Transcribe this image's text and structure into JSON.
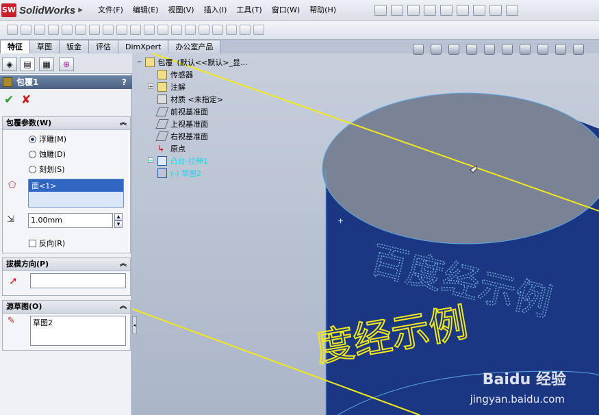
{
  "app": {
    "brand_logo": "SW",
    "name": "SolidWorks"
  },
  "menu": [
    "文件(F)",
    "编辑(E)",
    "视图(V)",
    "插入(I)",
    "工具(T)",
    "窗口(W)",
    "帮助(H)"
  ],
  "tabs": [
    "特征",
    "草图",
    "钣金",
    "评估",
    "DimXpert",
    "办公室产品"
  ],
  "active_tab": "特征",
  "property_manager": {
    "title": "包覆1",
    "help": "?",
    "ok": "✔",
    "cancel": "✘",
    "sections": {
      "params": {
        "title": "包覆参数(W)",
        "options": [
          "浮雕(M)",
          "蚀雕(D)",
          "刻划(S)"
        ],
        "selected_option": "浮雕(M)",
        "face_list": [
          "面<1>"
        ],
        "thickness": "1.00mm",
        "reverse_label": "反向(R)"
      },
      "pull": {
        "title": "拔模方向(P)",
        "value": ""
      },
      "source": {
        "title": "源草图(O)",
        "sketch": "草图2"
      }
    }
  },
  "tree": {
    "root": "包覆",
    "root_config": "(默认<<默认>_显...",
    "items": [
      "传感器",
      "注解",
      "材质 <未指定>",
      "前视基准面",
      "上视基准面",
      "右视基准面",
      "原点",
      "凸台-拉伸1",
      "(-) 草图2"
    ]
  },
  "model": {
    "cylinder_color": "#1c3782",
    "top_face_color": "#7a8296",
    "emboss_text": "百度经示例",
    "preview_text": "度经示例"
  },
  "watermark": {
    "brand": "Baidu 经验",
    "url": "jingyan.baidu.com"
  }
}
